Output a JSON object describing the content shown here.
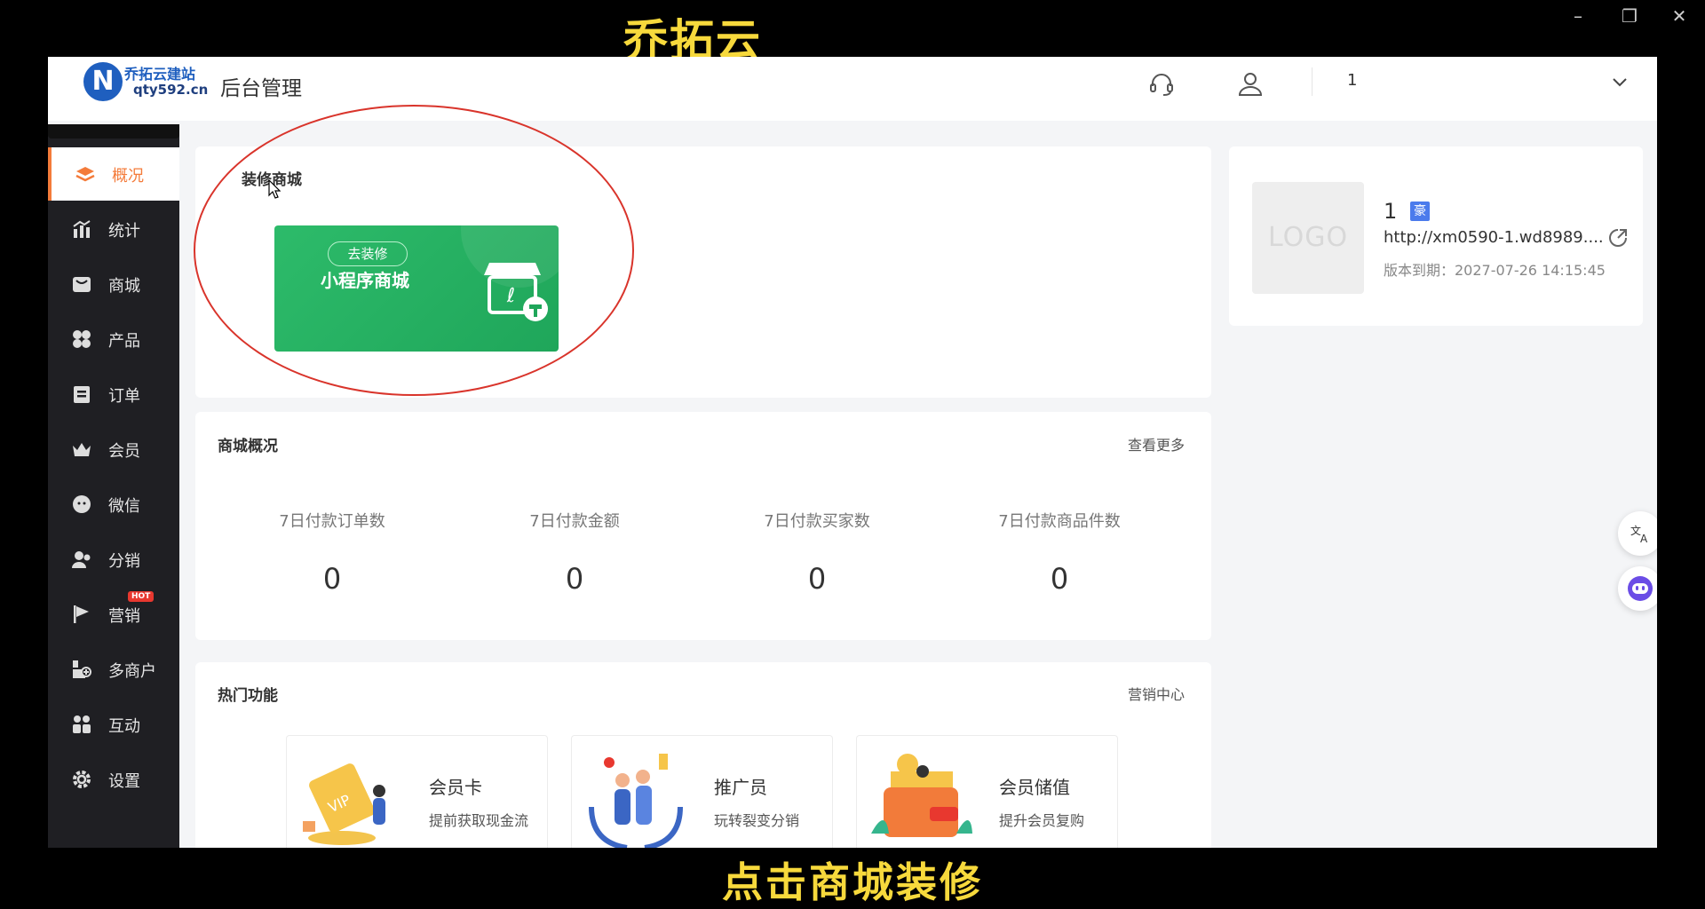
{
  "overlay": {
    "top_caption": "乔拓云",
    "bottom_caption": "点击商城装修"
  },
  "window_controls": {
    "minimize": "–",
    "restore": "❐",
    "close": "✕"
  },
  "header": {
    "logo_mark": "N",
    "logo_line1": "乔拓云建站",
    "logo_line2": "qty592.cn",
    "title": "后台管理",
    "user_name": "1"
  },
  "sidebar": {
    "items": [
      {
        "label": "概况",
        "icon": "layers-icon"
      },
      {
        "label": "统计",
        "icon": "chart-icon"
      },
      {
        "label": "商城",
        "icon": "store-icon"
      },
      {
        "label": "产品",
        "icon": "grid-icon"
      },
      {
        "label": "订单",
        "icon": "clipboard-icon"
      },
      {
        "label": "会员",
        "icon": "crown-icon"
      },
      {
        "label": "微信",
        "icon": "wechat-icon"
      },
      {
        "label": "分销",
        "icon": "users-icon"
      },
      {
        "label": "营销",
        "icon": "flag-icon",
        "badge": "HOT"
      },
      {
        "label": "多商户",
        "icon": "shop-plus-icon"
      },
      {
        "label": "互动",
        "icon": "people-icon"
      },
      {
        "label": "设置",
        "icon": "gear-icon"
      }
    ]
  },
  "decorate_card": {
    "title": "装修商城",
    "button": "去装修",
    "name": "小程序商城"
  },
  "overview_card": {
    "title": "商城概况",
    "more": "查看更多",
    "stats": [
      {
        "label": "7日付款订单数",
        "value": "0"
      },
      {
        "label": "7日付款金额",
        "value": "0"
      },
      {
        "label": "7日付款买家数",
        "value": "0"
      },
      {
        "label": "7日付款商品件数",
        "value": "0"
      }
    ]
  },
  "hot_card": {
    "title": "热门功能",
    "more": "营销中心",
    "features": [
      {
        "name": "会员卡",
        "desc": "提前获取现金流"
      },
      {
        "name": "推广员",
        "desc": "玩转裂变分销"
      },
      {
        "name": "会员储值",
        "desc": "提升会员复购"
      }
    ]
  },
  "site_card": {
    "logo_text": "LOGO",
    "name": "1",
    "badge": "豪",
    "url": "http://xm0590-1.wd8989....",
    "expire": "版本到期：2027-07-26 14:15:45"
  },
  "colors": {
    "accent": "#f47b3a",
    "sidebar_bg": "#1f1f23",
    "banner_green": "#2dbb6a",
    "caption_yellow": "#f7d93c",
    "annotation_red": "#d9342b"
  }
}
